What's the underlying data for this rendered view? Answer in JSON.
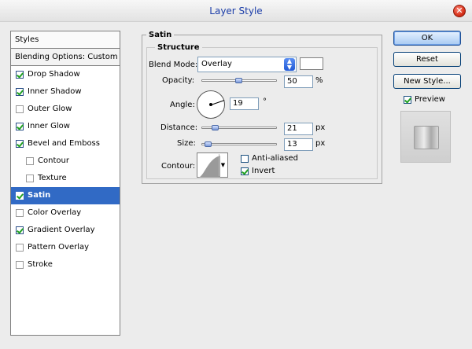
{
  "window": {
    "title": "Layer Style"
  },
  "styles_panel": {
    "header": "Styles",
    "blending": "Blending Options: Custom",
    "items": [
      {
        "label": "Drop Shadow",
        "checked": true,
        "sub": false,
        "selected": false
      },
      {
        "label": "Inner Shadow",
        "checked": true,
        "sub": false,
        "selected": false
      },
      {
        "label": "Outer Glow",
        "checked": false,
        "sub": false,
        "selected": false
      },
      {
        "label": "Inner Glow",
        "checked": true,
        "sub": false,
        "selected": false
      },
      {
        "label": "Bevel and Emboss",
        "checked": true,
        "sub": false,
        "selected": false
      },
      {
        "label": "Contour",
        "checked": false,
        "sub": true,
        "selected": false
      },
      {
        "label": "Texture",
        "checked": false,
        "sub": true,
        "selected": false
      },
      {
        "label": "Satin",
        "checked": true,
        "sub": false,
        "selected": true
      },
      {
        "label": "Color Overlay",
        "checked": false,
        "sub": false,
        "selected": false
      },
      {
        "label": "Gradient Overlay",
        "checked": true,
        "sub": false,
        "selected": false
      },
      {
        "label": "Pattern Overlay",
        "checked": false,
        "sub": false,
        "selected": false
      },
      {
        "label": "Stroke",
        "checked": false,
        "sub": false,
        "selected": false
      }
    ]
  },
  "satin": {
    "group_title": "Satin",
    "structure_title": "Structure",
    "blend_mode_label": "Blend Mode:",
    "blend_mode_value": "Overlay",
    "swatch_color": "#ffffff",
    "opacity_label": "Opacity:",
    "opacity_value": "50",
    "opacity_unit": "%",
    "opacity_fraction": 0.5,
    "angle_label": "Angle:",
    "angle_value": "19",
    "angle_unit": "°",
    "distance_label": "Distance:",
    "distance_value": "21",
    "distance_unit": "px",
    "size_label": "Size:",
    "size_value": "13",
    "size_unit": "px",
    "contour_label": "Contour:",
    "anti_aliased_label": "Anti-aliased",
    "anti_aliased_checked": false,
    "invert_label": "Invert",
    "invert_checked": true
  },
  "buttons": {
    "ok": "OK",
    "reset": "Reset",
    "new_style": "New Style...",
    "preview": "Preview",
    "preview_checked": true
  },
  "colors": {
    "selection": "#316ac5",
    "title": "#1b3da8",
    "check": "#21a121"
  }
}
